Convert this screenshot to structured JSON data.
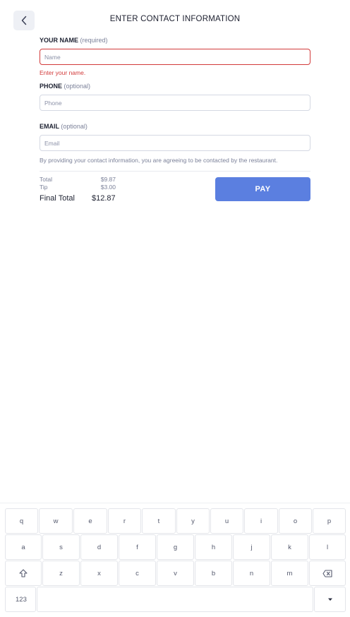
{
  "header": {
    "title": "ENTER CONTACT INFORMATION"
  },
  "form": {
    "name": {
      "label": "YOUR NAME",
      "hint": "(required)",
      "placeholder": "Name",
      "value": "",
      "error": "Enter your name."
    },
    "phone": {
      "label": "PHONE",
      "hint": "(optional)",
      "placeholder": "Phone",
      "value": ""
    },
    "email": {
      "label": "EMAIL",
      "hint": "(optional)",
      "placeholder": "Email",
      "value": ""
    },
    "disclaimer": "By providing your contact information, you are agreeing to be contacted by the restaurant."
  },
  "totals": {
    "total_label": "Total",
    "total_value": "$9.87",
    "tip_label": "Tip",
    "tip_value": "$3.00",
    "final_label": "Final Total",
    "final_value": "$12.87"
  },
  "pay_button": {
    "label": "PAY"
  },
  "colors": {
    "accent": "#5b7fe0",
    "error": "#d23a3a"
  },
  "keyboard": {
    "row1": [
      "q",
      "w",
      "e",
      "r",
      "t",
      "y",
      "u",
      "i",
      "o",
      "p"
    ],
    "row2": [
      "a",
      "s",
      "d",
      "f",
      "g",
      "h",
      "j",
      "k",
      "l"
    ],
    "row3": [
      "z",
      "x",
      "c",
      "v",
      "b",
      "n",
      "m"
    ],
    "shift_icon": "shift-icon",
    "backspace_icon": "backspace-icon",
    "numbers_label": "123",
    "collapse_icon": "caret-down-icon"
  }
}
